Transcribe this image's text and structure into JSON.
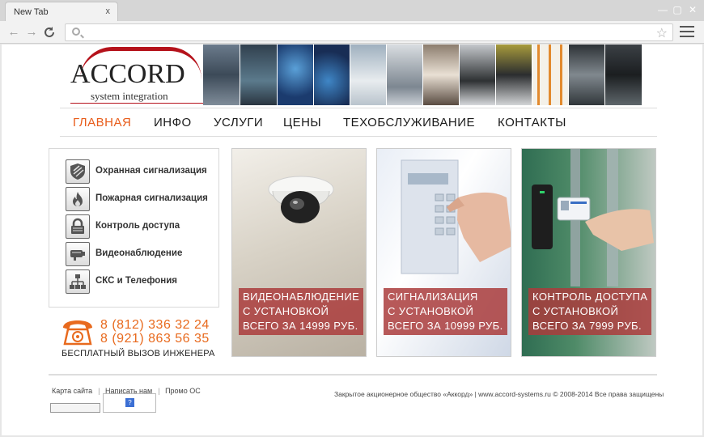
{
  "browser": {
    "tab_title": "New Tab",
    "tab_close": "x",
    "url": ""
  },
  "site": {
    "logo": {
      "name": "ACCORD",
      "tagline": "system integration"
    },
    "nav": [
      {
        "label": "ГЛАВНАЯ",
        "active": true
      },
      {
        "label": "ИНФО",
        "active": false
      },
      {
        "label": "УСЛУГИ",
        "active": false
      },
      {
        "label": "ЦЕНЫ",
        "active": false
      },
      {
        "label": "ТЕХОБСЛУЖИВАНИЕ",
        "active": false
      },
      {
        "label": "КОНТАКТЫ",
        "active": false
      }
    ],
    "services": [
      {
        "label": "Охранная сигнализация",
        "icon": "shield-icon"
      },
      {
        "label": "Пожарная сигнализация",
        "icon": "fire-icon"
      },
      {
        "label": "Контроль доступа",
        "icon": "lock-icon"
      },
      {
        "label": "Видеонаблюдение",
        "icon": "camera-icon"
      },
      {
        "label": "СКС и Телефония",
        "icon": "network-icon"
      }
    ],
    "phone": {
      "numbers": [
        "8 (812) 336 32 24",
        "8 (921) 863 56 35"
      ],
      "caption": "БЕСПЛАТНЫЙ ВЫЗОВ ИНЖЕНЕРА"
    },
    "promos": [
      {
        "lines": [
          "ВИДЕОНАБЛЮДЕНИЕ",
          "С УСТАНОВКОЙ",
          "ВСЕГО ЗА 14999 РУБ."
        ]
      },
      {
        "lines": [
          "СИГНАЛИЗАЦИЯ",
          "С УСТАНОВКОЙ",
          "ВСЕГО ЗА 10999 РУБ."
        ]
      },
      {
        "lines": [
          "КОНТРОЛЬ ДОСТУПА",
          "С УСТАНОВКОЙ",
          "ВСЕГО ЗА 7999 РУБ."
        ]
      }
    ],
    "footer": {
      "links": [
        "Карта сайта",
        "Написать нам",
        "Промо ОС"
      ],
      "copyright": "Закрытое акционерное общество «Аккорд» | www.accord-systems.ru © 2008-2014 Все права защищены"
    }
  },
  "colors": {
    "accent": "#e85c1a",
    "brand_red": "#b5121b",
    "caption_bg": "#a93c3c"
  }
}
